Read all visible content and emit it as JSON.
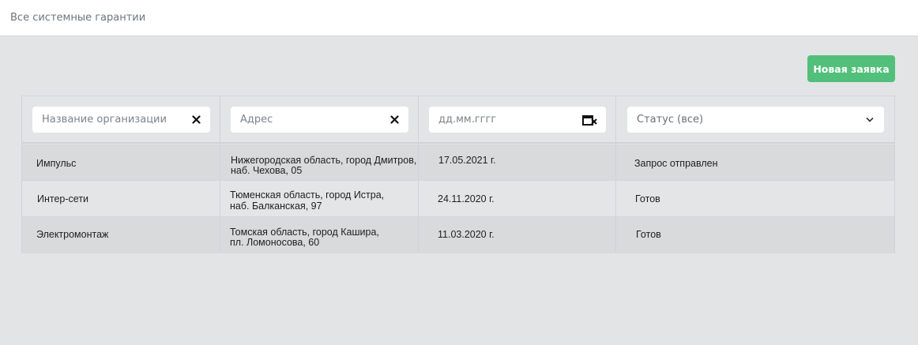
{
  "header": {
    "title": "Все системные гарантии"
  },
  "toolbar": {
    "new_request_label": "Новая заявка"
  },
  "filters": {
    "organization": {
      "placeholder": "Название организации",
      "icon": "close-icon"
    },
    "address": {
      "placeholder": "Адрес",
      "icon": "close-icon"
    },
    "date": {
      "placeholder": "дд.мм.гггг",
      "icon": "calendar-clear-icon"
    },
    "status": {
      "selected": "Статус (все)",
      "icon": "chevron-down-icon"
    }
  },
  "rows": [
    {
      "organization": "Импульс",
      "address_line1": "Нижегородская область, город Дмитров,",
      "address_line2": "наб. Чехова, 05",
      "date": "17.05.2021 г.",
      "status": "Запрос отправлен"
    },
    {
      "organization": "Интер-сети",
      "address_line1": "Тюменская область, город Истра,",
      "address_line2": "наб. Балканская, 97",
      "date": "24.11.2020 г.",
      "status": "Готов"
    },
    {
      "organization": "Электромонтаж",
      "address_line1": "Томская область, город Кашира,",
      "address_line2": "пл. Ломоносова, 60",
      "date": "11.03.2020 г.",
      "status": "Готов"
    }
  ],
  "colors": {
    "accent": "#52c07a",
    "background": "#e3e4e6",
    "row_dark": "#d9dadc",
    "row_light": "#e4e5e7"
  }
}
